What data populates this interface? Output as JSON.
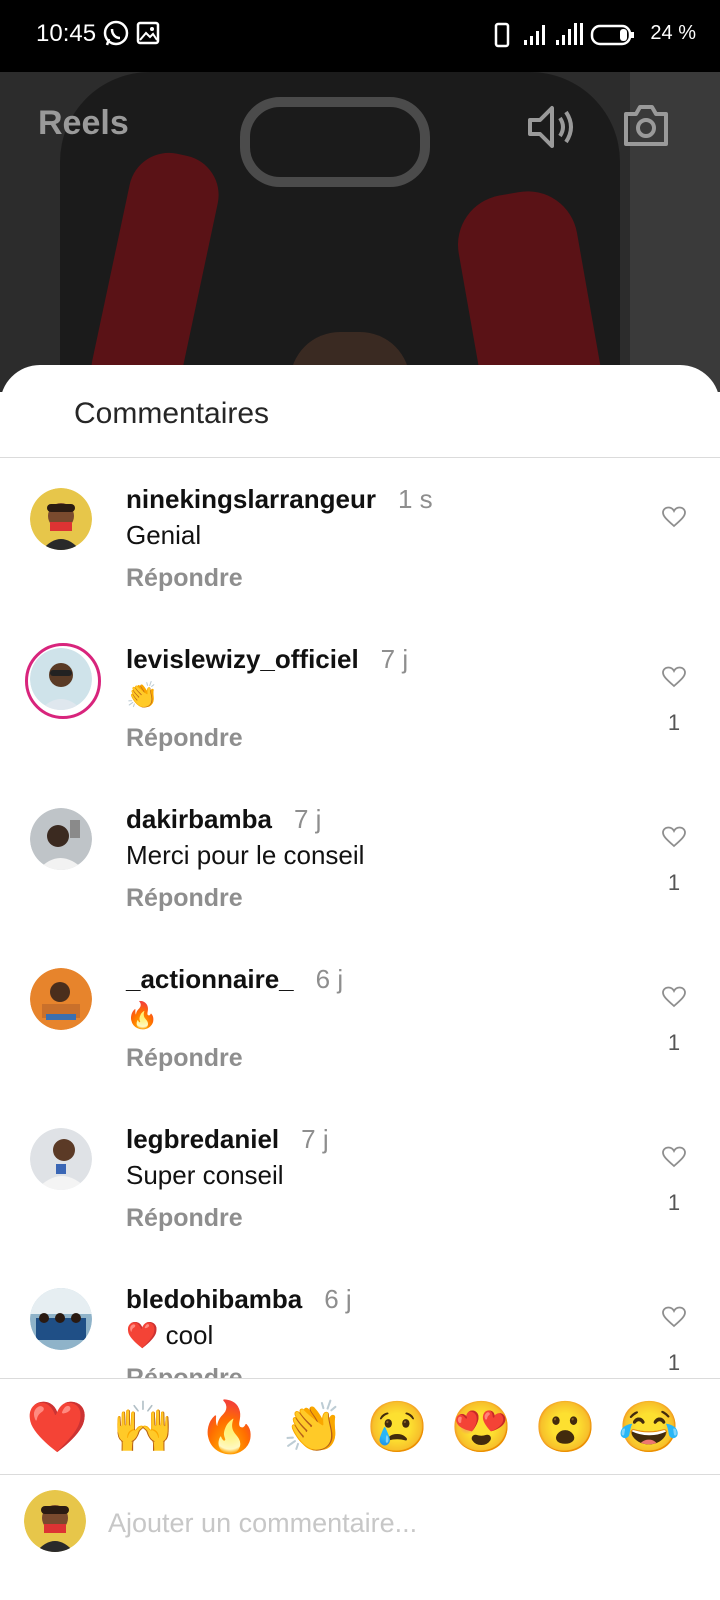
{
  "status_bar": {
    "time": "10:45",
    "battery": "24 %"
  },
  "reels": {
    "title": "Reels"
  },
  "comments_sheet": {
    "title": "Commentaires",
    "reply_label": "Répondre",
    "comments": [
      {
        "username": "ninekingslarrangeur",
        "time": "1 s",
        "text": "Genial",
        "likes": ""
      },
      {
        "username": "levislewizy_officiel",
        "time": "7 j",
        "text": "👏",
        "likes": "1"
      },
      {
        "username": "dakirbamba",
        "time": "7 j",
        "text": "Merci pour le conseil",
        "likes": "1"
      },
      {
        "username": "_actionnaire_",
        "time": "6 j",
        "text": "🔥",
        "likes": "1"
      },
      {
        "username": "legbredaniel",
        "time": "7 j",
        "text": "Super conseil",
        "likes": "1"
      },
      {
        "username": "bledohibamba",
        "time": "6 j",
        "text": "❤️ cool",
        "likes": "1"
      }
    ]
  },
  "emoji_bar": [
    "❤️",
    "🙌",
    "🔥",
    "👏",
    "😢",
    "😍",
    "😮",
    "😂"
  ],
  "composer": {
    "placeholder": "Ajouter un commentaire..."
  },
  "colors": {
    "accent_ring": "#d8247c",
    "text_secondary": "#8e8e8e",
    "divider": "#dbdbdb"
  }
}
